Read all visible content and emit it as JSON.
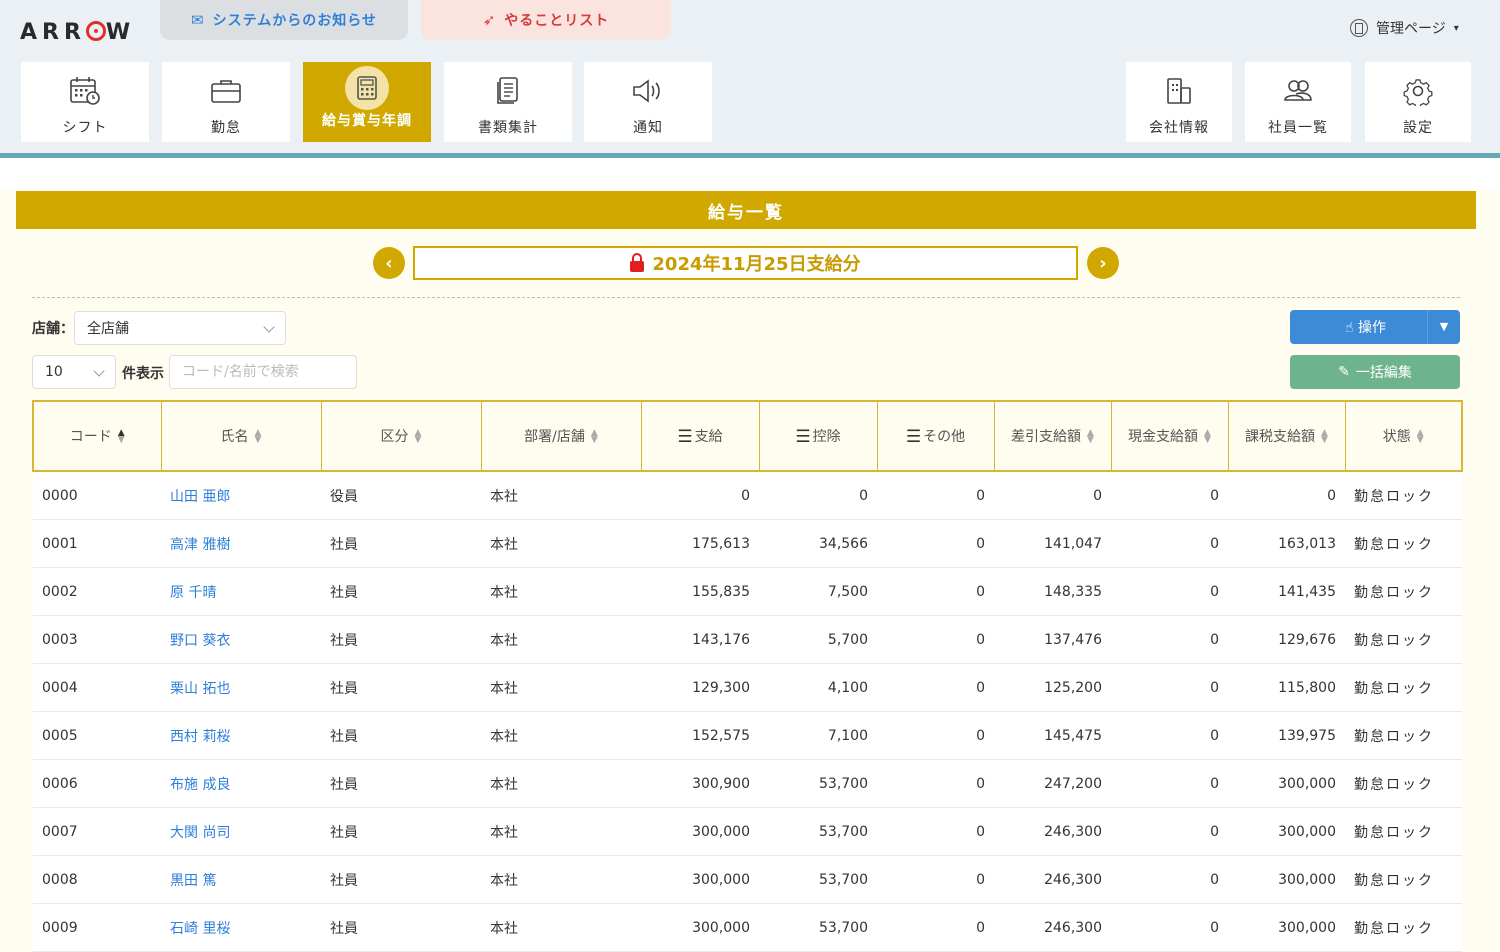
{
  "header": {
    "logo": "ARROW",
    "system_notice": "システムからのお知らせ",
    "todo_list": "やることリスト",
    "admin_label": "管理ページ",
    "nav": [
      {
        "label": "シフト"
      },
      {
        "label": "勤怠"
      },
      {
        "label": "給与賞与年調"
      },
      {
        "label": "書類集計"
      },
      {
        "label": "通知"
      }
    ],
    "nav_right": [
      {
        "label": "会社情報"
      },
      {
        "label": "社員一覧"
      },
      {
        "label": "設定"
      }
    ],
    "accent_color": "#d0a800"
  },
  "main": {
    "title": "給与一覧",
    "pay_date": "2024年11月25日支給分",
    "prev_glyph": "‹",
    "next_glyph": "›",
    "store_label": "店舗：",
    "store_value": "全店舗",
    "page_length": "10",
    "page_length_label": "件表示",
    "search_placeholder": "コード/名前で検索",
    "operate_button": "操作",
    "bulk_edit_button": "一括編集"
  },
  "table": {
    "headers": [
      "コード",
      "氏名",
      "区分",
      "部署/店舗",
      "支給",
      "控除",
      "その他",
      "差引支給額",
      "現金支給額",
      "課税支給額",
      "状態"
    ],
    "rows": [
      [
        "0000",
        "山田 亜郎",
        "役員",
        "本社",
        "0",
        "0",
        "0",
        "0",
        "0",
        "0",
        "勤怠ロック"
      ],
      [
        "0001",
        "高津 雅樹",
        "社員",
        "本社",
        "175,613",
        "34,566",
        "0",
        "141,047",
        "0",
        "163,013",
        "勤怠ロック"
      ],
      [
        "0002",
        "原 千晴",
        "社員",
        "本社",
        "155,835",
        "7,500",
        "0",
        "148,335",
        "0",
        "141,435",
        "勤怠ロック"
      ],
      [
        "0003",
        "野口 葵衣",
        "社員",
        "本社",
        "143,176",
        "5,700",
        "0",
        "137,476",
        "0",
        "129,676",
        "勤怠ロック"
      ],
      [
        "0004",
        "栗山 拓也",
        "社員",
        "本社",
        "129,300",
        "4,100",
        "0",
        "125,200",
        "0",
        "115,800",
        "勤怠ロック"
      ],
      [
        "0005",
        "西村 莉桜",
        "社員",
        "本社",
        "152,575",
        "7,100",
        "0",
        "145,475",
        "0",
        "139,975",
        "勤怠ロック"
      ],
      [
        "0006",
        "布施 成良",
        "社員",
        "本社",
        "300,900",
        "53,700",
        "0",
        "247,200",
        "0",
        "300,000",
        "勤怠ロック"
      ],
      [
        "0007",
        "大関 尚司",
        "社員",
        "本社",
        "300,000",
        "53,700",
        "0",
        "246,300",
        "0",
        "300,000",
        "勤怠ロック"
      ],
      [
        "0008",
        "黒田 篤",
        "社員",
        "本社",
        "300,000",
        "53,700",
        "0",
        "246,300",
        "0",
        "300,000",
        "勤怠ロック"
      ],
      [
        "0009",
        "石崎 里桜",
        "社員",
        "本社",
        "300,000",
        "53,700",
        "0",
        "246,300",
        "0",
        "300,000",
        "勤怠ロック"
      ]
    ]
  }
}
